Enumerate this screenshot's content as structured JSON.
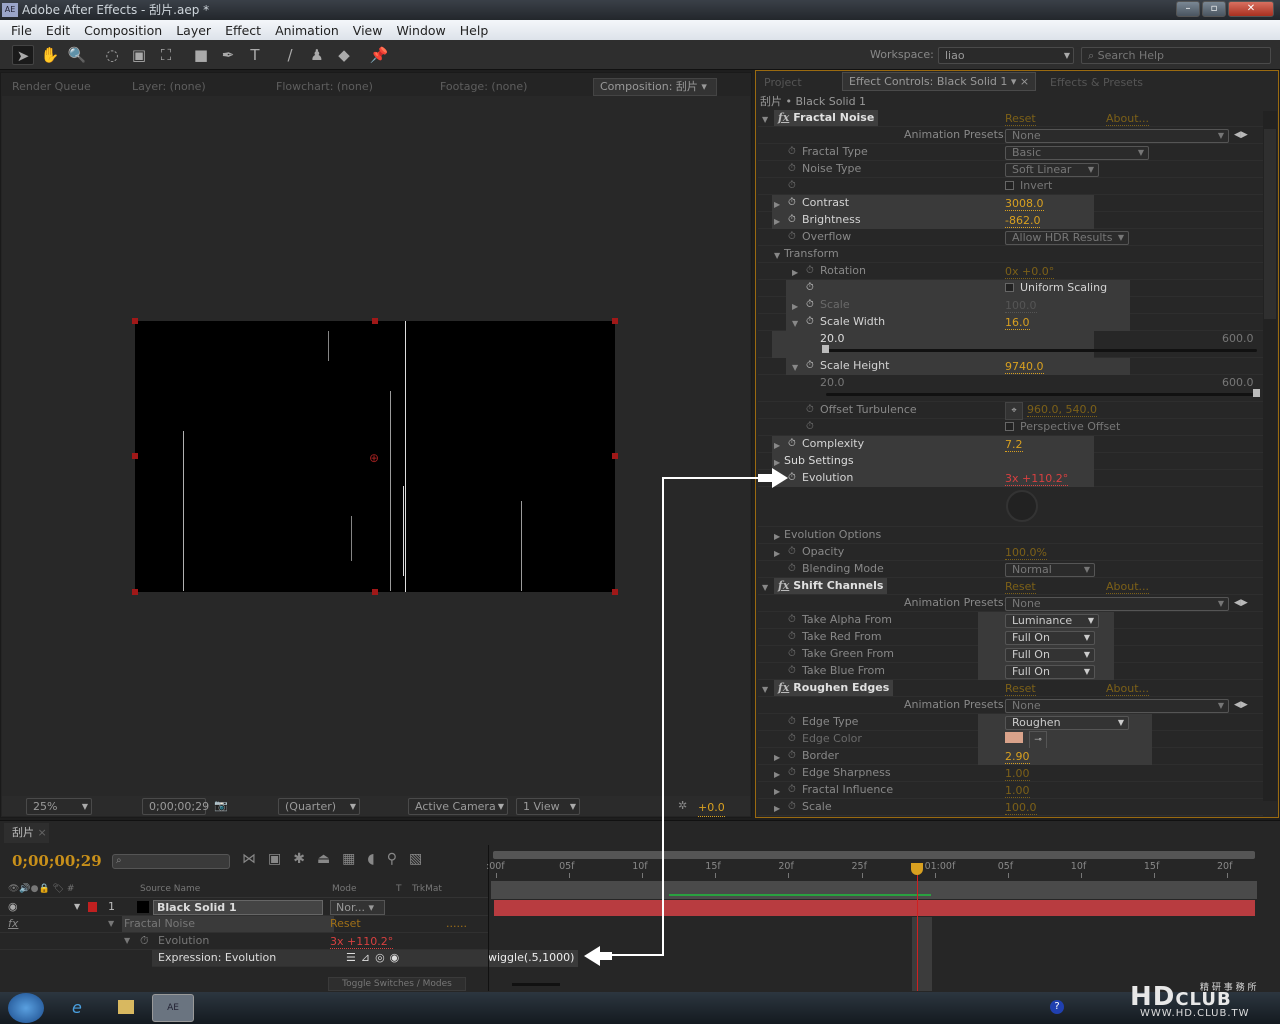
{
  "window": {
    "title": "Adobe After Effects - 刮片.aep *",
    "app_badge": "AE"
  },
  "menu": [
    "File",
    "Edit",
    "Composition",
    "Layer",
    "Effect",
    "Animation",
    "View",
    "Window",
    "Help"
  ],
  "toolbar": {
    "tools": [
      {
        "icon": "selection-arrow-icon",
        "glyph": "➤",
        "selected": true
      },
      {
        "icon": "hand-icon",
        "glyph": "✋"
      },
      {
        "icon": "zoom-icon",
        "glyph": "🔍"
      },
      {
        "icon": "rotate-icon",
        "glyph": "◌"
      },
      {
        "icon": "camera-orbit-icon",
        "glyph": "▣"
      },
      {
        "icon": "pan-behind-icon",
        "glyph": "⛶"
      },
      {
        "icon": "rectangle-mask-icon",
        "glyph": "■"
      },
      {
        "icon": "pen-icon",
        "glyph": "✒"
      },
      {
        "icon": "type-icon",
        "glyph": "T"
      },
      {
        "icon": "brush-icon",
        "glyph": "/"
      },
      {
        "icon": "clone-stamp-icon",
        "glyph": "♟"
      },
      {
        "icon": "eraser-icon",
        "glyph": "◆"
      },
      {
        "icon": "puppet-pin-icon",
        "glyph": "📌"
      }
    ],
    "workspace_label": "Workspace:",
    "workspace_value": "liao",
    "search_placeholder": "Search Help"
  },
  "left_panel": {
    "tabs": [
      "Render Queue",
      "Layer: (none)",
      "Flowchart: (none)",
      "Footage: (none)",
      "Composition: 刮片"
    ],
    "comp_tab_label": "刮片"
  },
  "viewer_bar": {
    "zoom": "25%",
    "timecode": "0;00;00;29",
    "resolution": "(Quarter)",
    "camera": "Active Camera",
    "views": "1 View",
    "exposure": "+0.0"
  },
  "right_panel": {
    "tabs": [
      "Project",
      "Effect Controls: Black Solid 1",
      "Effects & Presets"
    ],
    "breadcrumb": "刮片 • Black Solid 1",
    "rows": [
      {
        "type": "fx",
        "label": "Fractal Noise",
        "reset": "Reset",
        "about": "About..."
      },
      {
        "type": "presets",
        "label": "Animation Presets:",
        "value": "None"
      },
      {
        "type": "select",
        "level": 0,
        "label": "Fractal Type",
        "value": "Basic"
      },
      {
        "type": "select",
        "level": 0,
        "label": "Noise Type",
        "value": "Soft Linear"
      },
      {
        "type": "check",
        "level": 0,
        "label": "",
        "value": "Invert",
        "checked": false
      },
      {
        "type": "num",
        "level": 0,
        "label": "Contrast",
        "value": "3008.0",
        "twirl": true,
        "highlight": true
      },
      {
        "type": "num",
        "level": 0,
        "label": "Brightness",
        "value": "-862.0",
        "twirl": true,
        "highlight": true
      },
      {
        "type": "select",
        "level": 0,
        "label": "Overflow",
        "value": "Allow HDR Results"
      },
      {
        "type": "group",
        "level": 0,
        "label": "Transform",
        "open": true
      },
      {
        "type": "num",
        "level": 1,
        "label": "Rotation",
        "value": "0x +0.0°",
        "twirl": true
      },
      {
        "type": "check",
        "level": 1,
        "label": "",
        "value": "Uniform Scaling",
        "checked": false,
        "highlight": true,
        "bright": true
      },
      {
        "type": "num",
        "level": 1,
        "label": "Scale",
        "value": "100.0",
        "twirl": true,
        "disabled": true,
        "highlight": true
      },
      {
        "type": "num",
        "level": 1,
        "label": "Scale Width",
        "value": "16.0",
        "twirl": true,
        "open": true,
        "highlight": true
      },
      {
        "type": "slider",
        "min": "20.0",
        "max": "600.0",
        "fraction": 0,
        "highlight": true
      },
      {
        "type": "num",
        "level": 1,
        "label": "Scale Height",
        "value": "9740.0",
        "twirl": true,
        "open": true,
        "highlight": true
      },
      {
        "type": "slider",
        "min": "20.0",
        "max": "600.0",
        "fraction": 1
      },
      {
        "type": "point",
        "level": 1,
        "label": "Offset Turbulence",
        "value": "960.0, 540.0"
      },
      {
        "type": "check",
        "level": 1,
        "label": "",
        "value": "Perspective Offset",
        "checked": false
      },
      {
        "type": "num",
        "level": 0,
        "label": "Complexity",
        "value": "7.2",
        "twirl": true,
        "highlight": true
      },
      {
        "type": "group",
        "level": 0,
        "label": "Sub Settings",
        "open": false,
        "highlight": true
      },
      {
        "type": "num",
        "level": 0,
        "label": "Evolution",
        "value": "3x +110.2°",
        "expression": true,
        "highlight": true
      },
      {
        "type": "dial"
      },
      {
        "type": "group",
        "level": 0,
        "label": "Evolution Options",
        "open": false,
        "dimmed": true
      },
      {
        "type": "num",
        "level": 0,
        "label": "Opacity",
        "value": "100.0%",
        "twirl": true
      },
      {
        "type": "select",
        "level": 0,
        "label": "Blending Mode",
        "value": "Normal"
      },
      {
        "type": "fx",
        "label": "Shift Channels",
        "reset": "Reset",
        "about": "About..."
      },
      {
        "type": "presets",
        "label": "Animation Presets:",
        "value": "None"
      },
      {
        "type": "select",
        "level": 0,
        "label": "Take Alpha From",
        "value": "Luminance",
        "box": true
      },
      {
        "type": "select",
        "level": 0,
        "label": "Take Red From",
        "value": "Full On",
        "box": true
      },
      {
        "type": "select",
        "level": 0,
        "label": "Take Green From",
        "value": "Full On",
        "box": true
      },
      {
        "type": "select",
        "level": 0,
        "label": "Take Blue From",
        "value": "Full On",
        "box": true
      },
      {
        "type": "fx",
        "label": "Roughen Edges",
        "reset": "Reset",
        "about": "About..."
      },
      {
        "type": "presets",
        "label": "Animation Presets:",
        "value": "None"
      },
      {
        "type": "select",
        "level": 0,
        "label": "Edge Type",
        "value": "Roughen",
        "box": true
      },
      {
        "type": "color",
        "level": 0,
        "label": "Edge Color",
        "value": "#d9a28a",
        "disabled": true,
        "box": true
      },
      {
        "type": "num",
        "level": 0,
        "label": "Border",
        "value": "2.90",
        "twirl": true,
        "box": true,
        "brightval": true
      },
      {
        "type": "num",
        "level": 0,
        "label": "Edge Sharpness",
        "value": "1.00",
        "twirl": true
      },
      {
        "type": "num",
        "level": 0,
        "label": "Fractal Influence",
        "value": "1.00",
        "twirl": true
      },
      {
        "type": "num",
        "level": 0,
        "label": "Scale",
        "value": "100.0",
        "twirl": true
      }
    ]
  },
  "timeline": {
    "comp_tab": "刮片",
    "timecode": "0;00;00;29",
    "columns": {
      "source_name": "Source Name",
      "mode": "Mode",
      "t": "T",
      "trkmat": "TrkMat"
    },
    "layer": {
      "number": "1",
      "name": "Black Solid 1",
      "mode": "Nor...",
      "label_color": "#c02020"
    },
    "effect_row": {
      "name": "Fractal Noise",
      "reset": "Reset",
      "dots": "......"
    },
    "property_row": {
      "name": "Evolution",
      "value": "3x +110.2°"
    },
    "expression_row": {
      "label": "Expression: Evolution",
      "code": "wiggle(.5,1000)"
    },
    "ruler": [
      ":00f",
      "05f",
      "10f",
      "15f",
      "20f",
      "25f",
      "01:00f",
      "05f",
      "10f",
      "15f",
      "20f"
    ],
    "playhead_frame": 29,
    "toggle_label": "Toggle Switches / Modes"
  },
  "watermark": {
    "logo": "HDCLUB",
    "sub": "精 研 事 務 所",
    "url": "WWW.HD.CLUB.TW"
  },
  "colors": {
    "accent": "#d8a020",
    "expression_red": "#d84040",
    "layer_bar": "#b83c40",
    "panel_border": "#9a6a10"
  }
}
